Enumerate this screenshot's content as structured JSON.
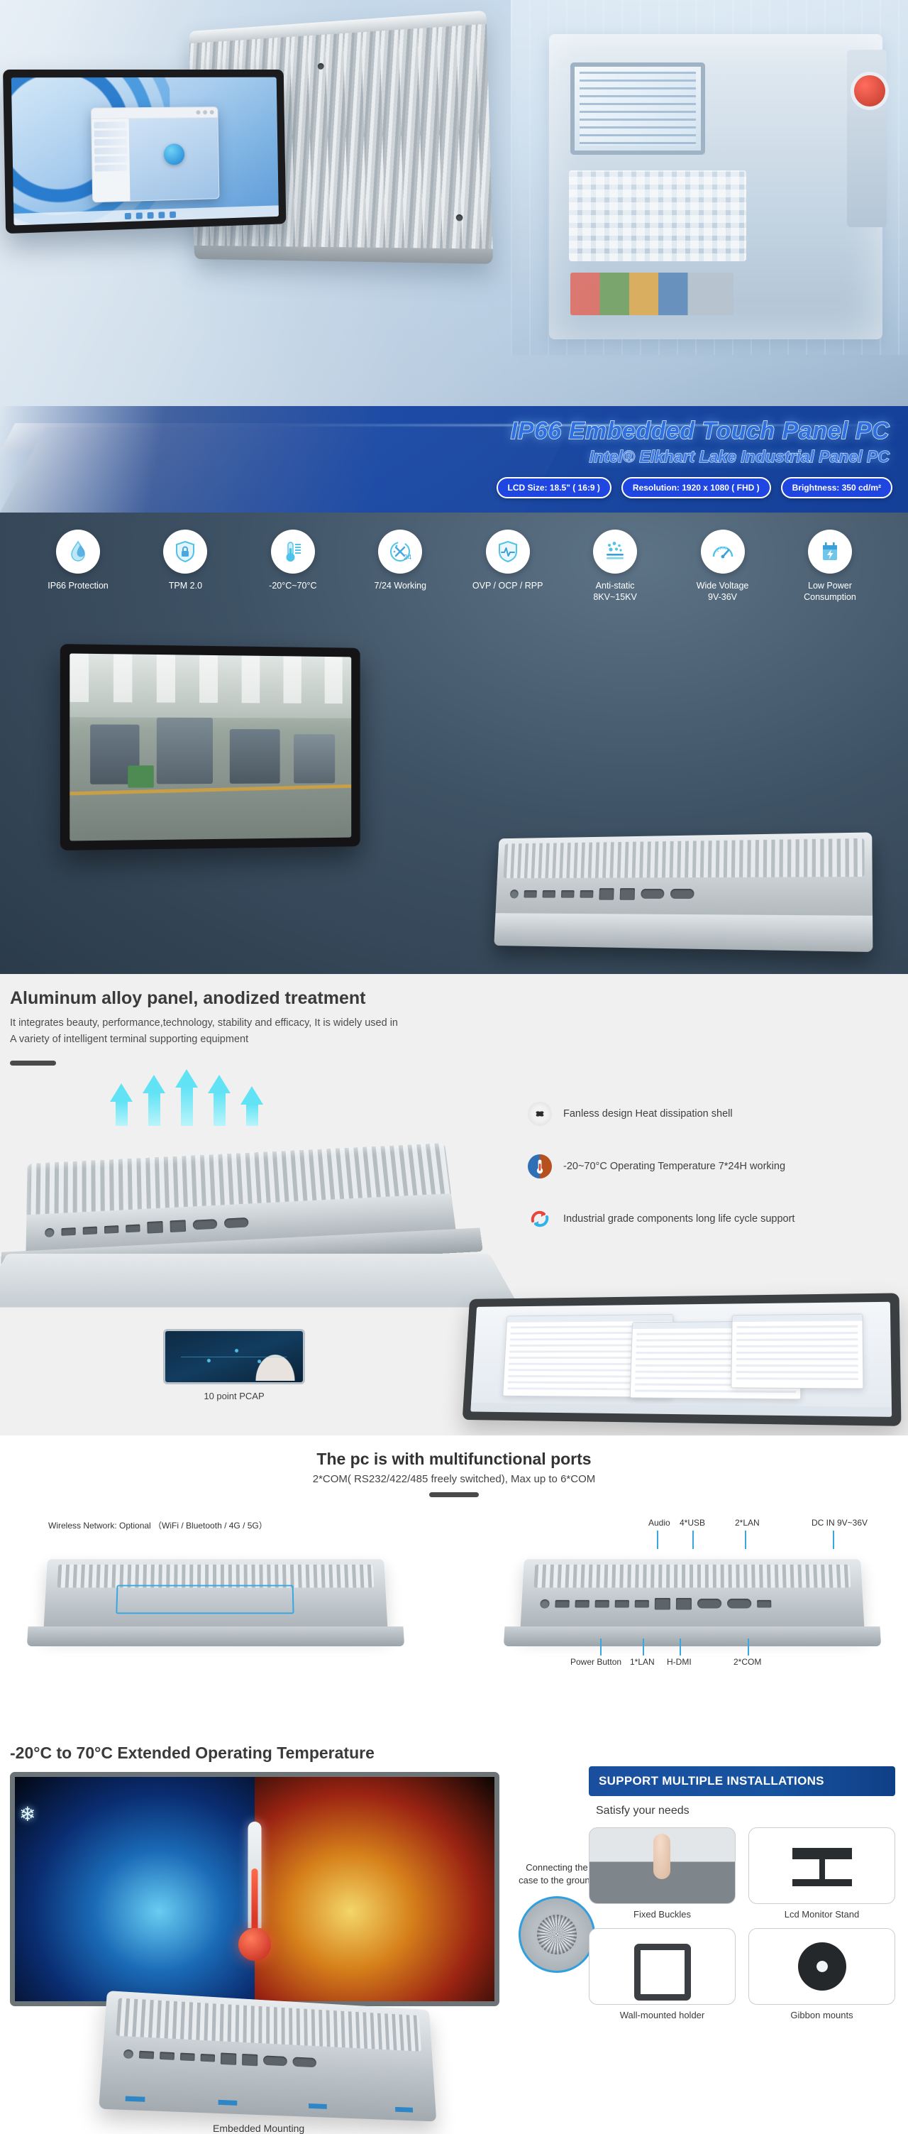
{
  "hero": {
    "title": "IP66 Embedded Touch Panel PC",
    "subtitle": "Intel® Elkhart Lake Industrial Panel PC",
    "chips": [
      "LCD Size: 18.5\" ( 16:9 )",
      "Resolution: 1920 x 1080 ( FHD )",
      "Brightness: 350 cd/m²"
    ]
  },
  "features": {
    "items": [
      {
        "icon": "water-drop-icon",
        "label": "IP66 Protection"
      },
      {
        "icon": "shield-lock-icon",
        "label": "TPM 2.0"
      },
      {
        "icon": "thermometer-icon",
        "label": "-20°C~70°C"
      },
      {
        "icon": "clock-24-icon",
        "label": "7/24 Working"
      },
      {
        "icon": "shield-pulse-icon",
        "label": "OVP / OCP / RPP"
      },
      {
        "icon": "anti-static-icon",
        "label": "Anti-static\n8KV~15KV"
      },
      {
        "icon": "gauge-icon",
        "label": "Wide Voltage\n9V-36V"
      },
      {
        "icon": "battery-bolt-icon",
        "label": "Low Power\nConsumption"
      }
    ]
  },
  "aluminum": {
    "heading": "Aluminum alloy panel, anodized treatment",
    "description": "It integrates beauty, performance,technology, stability and efficacy, It is widely used in\nA variety of intelligent terminal supporting equipment",
    "bullets": [
      {
        "icon": "fan-icon",
        "text": "Fanless design Heat dissipation shell"
      },
      {
        "icon": "temperature-icon",
        "text": "-20~70°C Operating Temperature 7*24H working"
      },
      {
        "icon": "recycle-icon",
        "text": "Industrial grade components long life cycle support"
      }
    ],
    "pcap_caption": "10 point PCAP"
  },
  "ports": {
    "heading": "The pc is with multifunctional ports",
    "subheading": "2*COM( RS232/422/485 freely switched), Max up to 6*COM",
    "left_label": "Wireless Network: Optional （WiFi / Bluetooth / 4G / 5G）",
    "top_labels": [
      "Audio",
      "4*USB",
      "2*LAN",
      "DC IN 9V~36V"
    ],
    "bottom_labels": [
      "Power Button",
      "1*LAN",
      "H-DMI",
      "2*COM"
    ]
  },
  "temperature": {
    "heading": "-20°C to 70°C Extended Operating Temperature",
    "ground_caption": "Connecting the\ncase to the ground",
    "embedded_caption": "Embedded Mounting"
  },
  "install": {
    "banner": "SUPPORT MULTIPLE INSTALLATIONS",
    "subtitle": "Satisfy your needs",
    "cards": [
      {
        "thumb": "fixed-buckles-thumb",
        "caption": "Fixed Buckles"
      },
      {
        "thumb": "lcd-monitor-stand-thumb",
        "caption": "Lcd Monitor Stand"
      },
      {
        "thumb": "wall-mounted-holder-thumb",
        "caption": "Wall-mounted holder"
      },
      {
        "thumb": "gibbon-mounts-thumb",
        "caption": "Gibbon mounts"
      }
    ]
  },
  "colors": {
    "banner_blue": "#1f46e0",
    "accent_cyan": "#3aa6e0",
    "install_banner": "#17539f",
    "dark_text": "#3a3a3a"
  }
}
